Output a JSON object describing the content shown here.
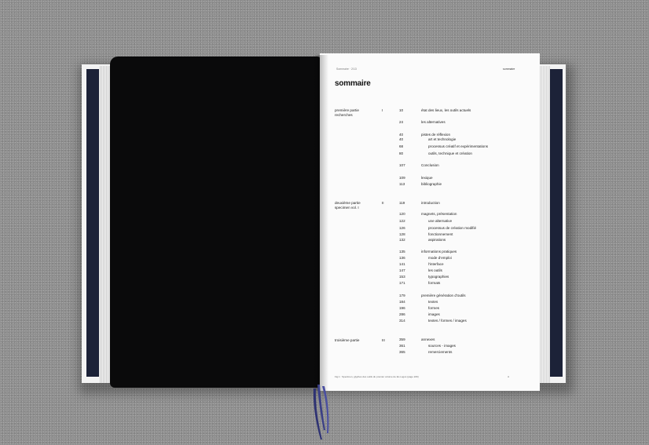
{
  "running_head_left": "Sommaire · 2/13",
  "running_head_right": "sommaire",
  "title": "sommaire",
  "parts": [
    {
      "label": "première partie",
      "sub": "recherches",
      "num": "I"
    },
    {
      "label": "deuxième partie",
      "sub": "specimen vol. I",
      "num": "II"
    },
    {
      "label": "troisième partie",
      "sub": "",
      "num": "III"
    }
  ],
  "entries": [
    {
      "page": "10",
      "text": "état des lieux, les outils actuels",
      "indent": false
    },
    {
      "page": "24",
      "text": "les alternatives",
      "indent": false
    },
    {
      "page": "40",
      "text": "pistes de réflexion",
      "indent": false
    },
    {
      "page": "40",
      "text": "art et technologie",
      "indent": true
    },
    {
      "page": "68",
      "text": "processus créatif et expérimentations",
      "indent": true
    },
    {
      "page": "80",
      "text": "outils, technique et création",
      "indent": true
    },
    {
      "page": "107",
      "text": "Conclusion",
      "indent": false
    },
    {
      "page": "109",
      "text": "lexique",
      "indent": false
    },
    {
      "page": "113",
      "text": "bibliographie",
      "indent": false
    },
    {
      "page": "119",
      "text": "introduction",
      "indent": false
    },
    {
      "page": "120",
      "text": "magnets, présentation",
      "indent": false
    },
    {
      "page": "122",
      "text": "une alternative",
      "indent": true
    },
    {
      "page": "126",
      "text": "processus de création modifié",
      "indent": true
    },
    {
      "page": "128",
      "text": "fonctionnement",
      "indent": true
    },
    {
      "page": "132",
      "text": "aspirations",
      "indent": true
    },
    {
      "page": "135",
      "text": "informations pratiques",
      "indent": false
    },
    {
      "page": "136",
      "text": "mode d'emploi",
      "indent": true
    },
    {
      "page": "141",
      "text": "l'interface",
      "indent": true
    },
    {
      "page": "147",
      "text": "les outils",
      "indent": true
    },
    {
      "page": "153",
      "text": "typographies",
      "indent": true
    },
    {
      "page": "171",
      "text": "formats",
      "indent": true
    },
    {
      "page": "179",
      "text": "première génération d'outils",
      "indent": false
    },
    {
      "page": "184",
      "text": "textes",
      "indent": true
    },
    {
      "page": "196",
      "text": "formes",
      "indent": true
    },
    {
      "page": "286",
      "text": "images",
      "indent": true
    },
    {
      "page": "314",
      "text": "textes / formes / images",
      "indent": true
    },
    {
      "page": "359",
      "text": "annexes",
      "indent": false
    },
    {
      "page": "361",
      "text": "sources - images",
      "indent": true
    },
    {
      "page": "365",
      "text": "remerciements",
      "indent": true
    }
  ],
  "footnote": "Fig.1 : Specimen, glyphes des outils du premier volume de Ex-Logos (page 229)",
  "page_number": "4",
  "colors": {
    "background": "#8f8f8f",
    "black_page": "#0a0a0b",
    "white_page": "#fbfbfb",
    "binding_band": "#1c2238",
    "ribbon": "#3a3f86"
  }
}
